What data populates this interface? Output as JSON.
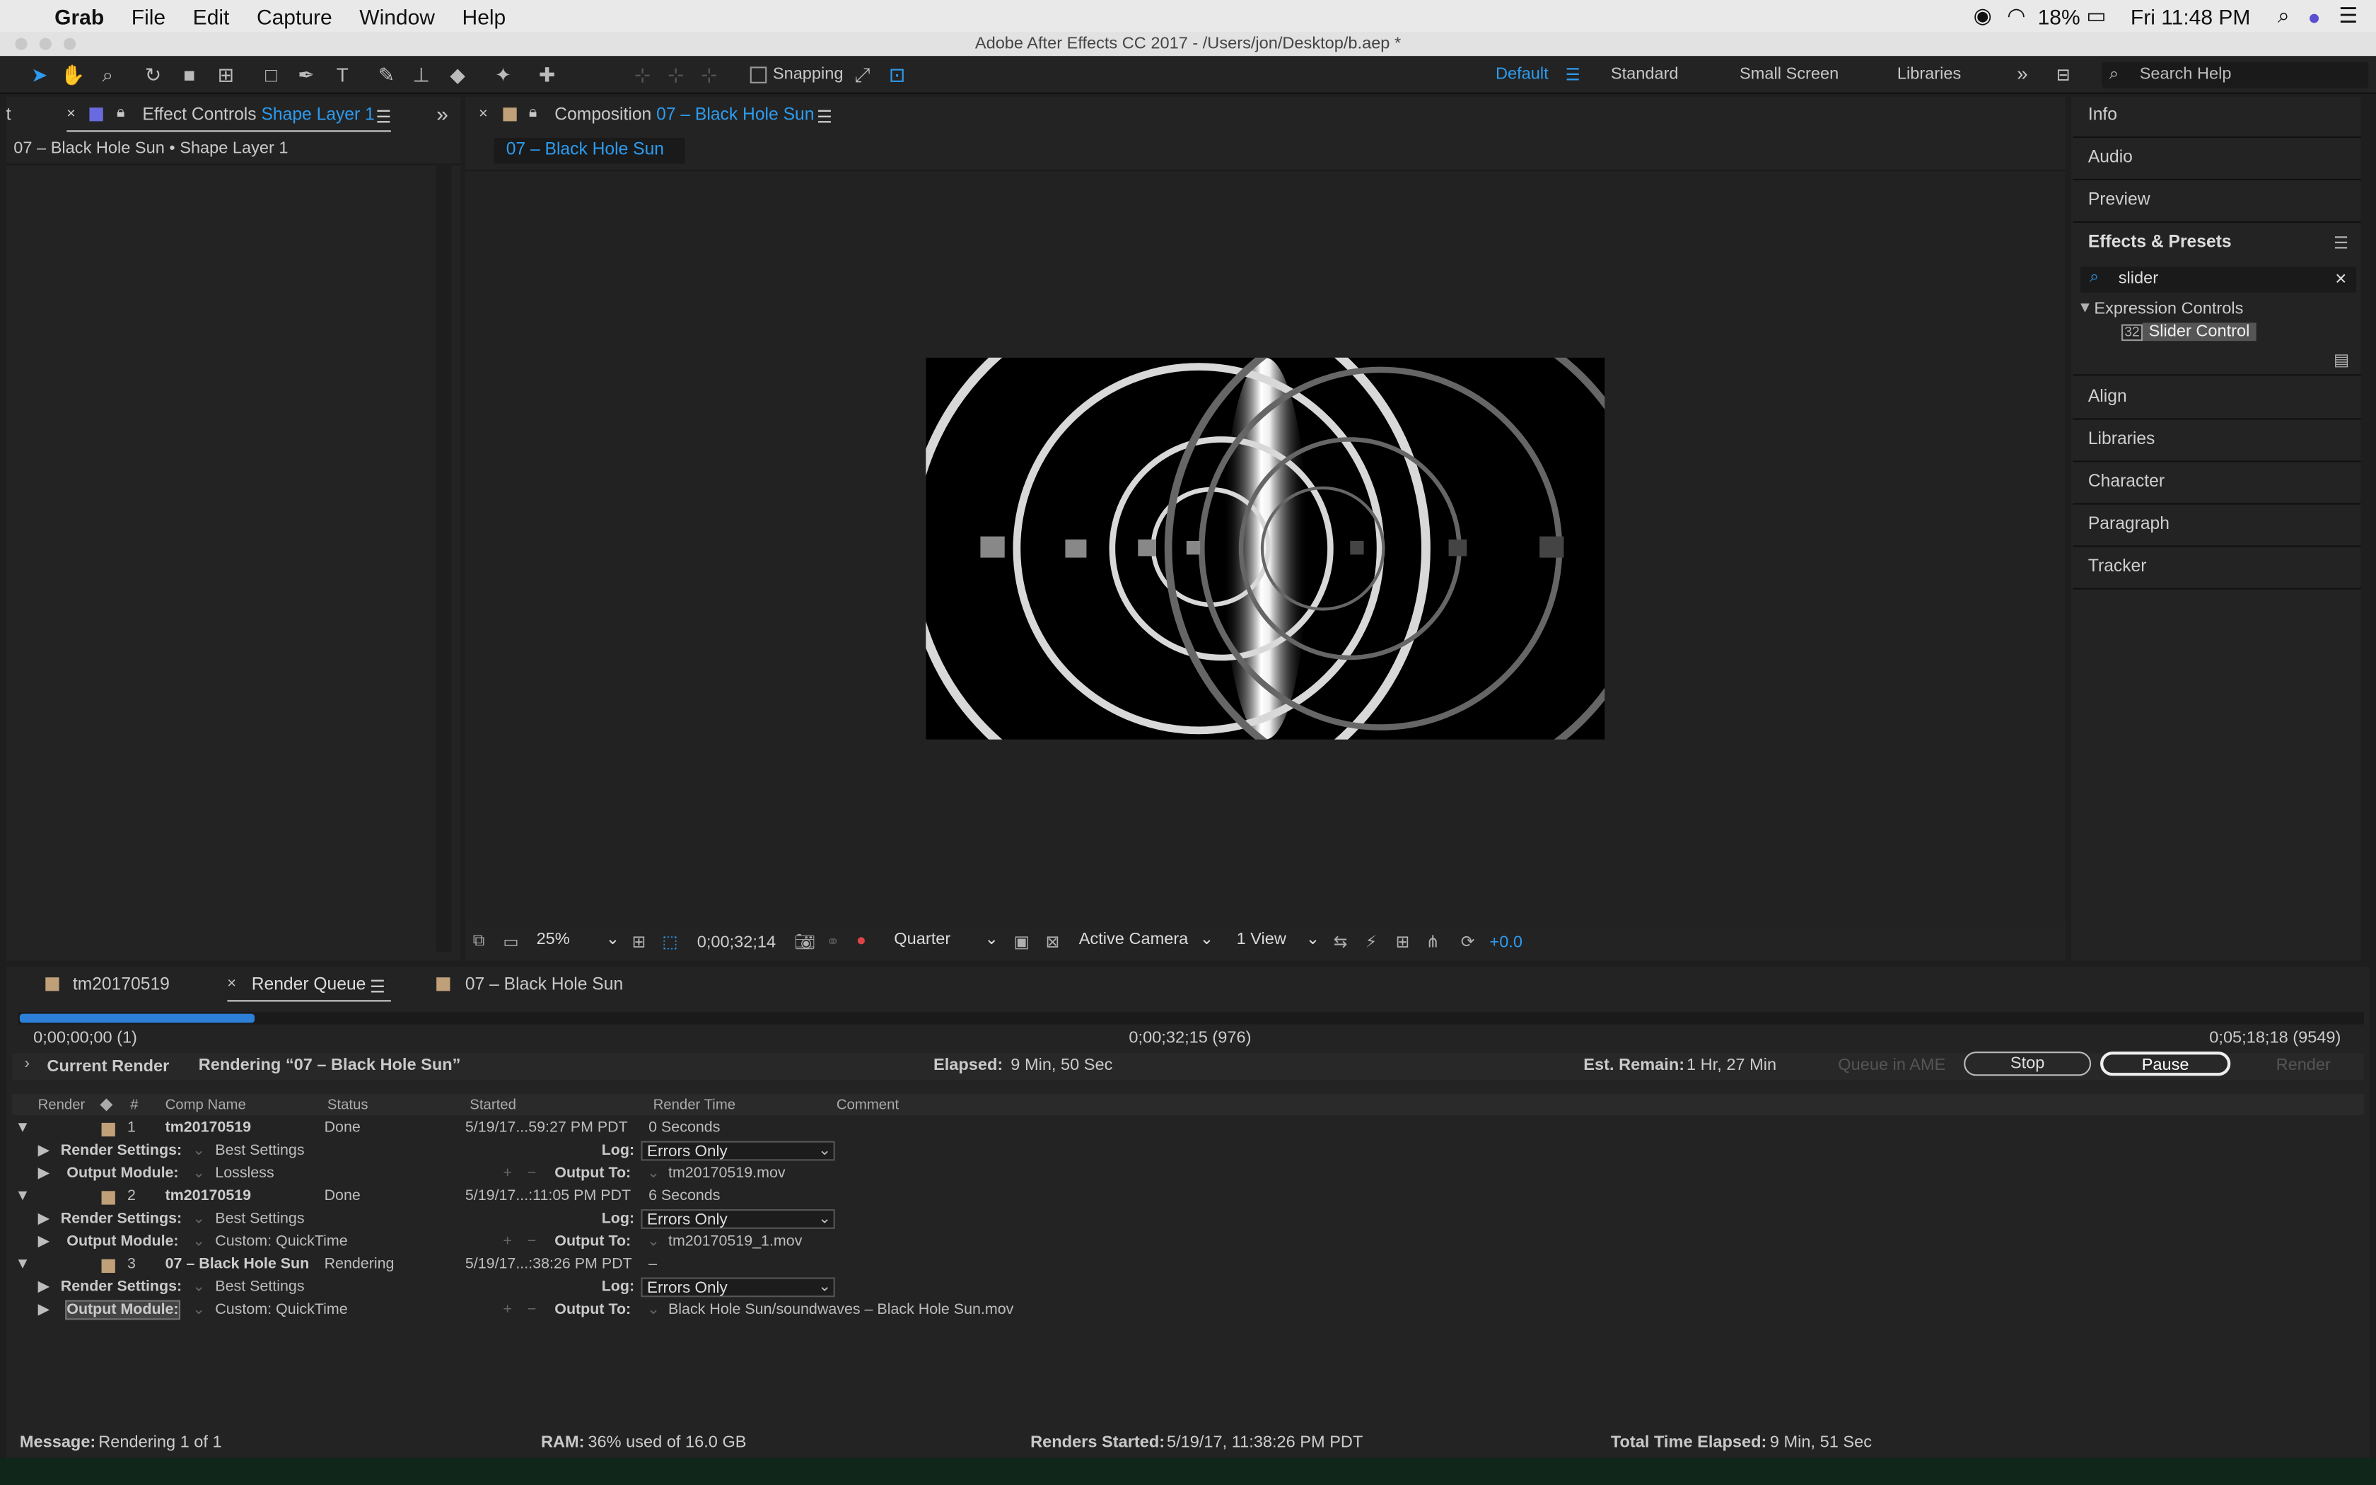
{
  "menubar": {
    "apple": "",
    "app": "Grab",
    "items": [
      "File",
      "Edit",
      "Capture",
      "Window",
      "Help"
    ],
    "battery": "18%",
    "clock": "Fri 11:48 PM"
  },
  "window": {
    "title": "Adobe After Effects CC 2017 - /Users/jon/Desktop/b.aep *"
  },
  "toolbar": {
    "snapping": "Snapping",
    "workspaces": [
      "Default",
      "Standard",
      "Small Screen",
      "Libraries"
    ],
    "search_placeholder": "Search Help"
  },
  "effect_controls": {
    "tab_prefix": "Effect Controls",
    "layer": "Shape Layer 1",
    "breadcrumb": "07 – Black Hole Sun • Shape Layer 1"
  },
  "composition": {
    "tab_prefix": "Composition",
    "comp": "07 – Black Hole Sun",
    "subtab": "07 – Black Hole Sun",
    "zoom": "25%",
    "timecode": "0;00;32;14",
    "resolution": "Quarter",
    "camera": "Active Camera",
    "views": "1 View",
    "exposure": "+0.0"
  },
  "right_panel": {
    "info": "Info",
    "audio": "Audio",
    "preview": "Preview",
    "effects_presets": "Effects & Presets",
    "search_value": "slider",
    "category": "Expression Controls",
    "effect": "Slider Control",
    "align": "Align",
    "libraries": "Libraries",
    "character": "Character",
    "paragraph": "Paragraph",
    "tracker": "Tracker"
  },
  "bottom_tabs": {
    "tab1": "tm20170519",
    "tab2": "Render Queue",
    "tab3": "07 – Black Hole Sun"
  },
  "render": {
    "progress": 0.1,
    "start_tc": "0;00;00;00 (1)",
    "current_tc": "0;00;32;15 (976)",
    "end_tc": "0;05;18;18 (9549)",
    "current_render_label": "Current Render",
    "rendering_text": "Rendering “07 – Black Hole Sun”",
    "elapsed_label": "Elapsed:",
    "elapsed": "9 Min, 50 Sec",
    "remain_label": "Est. Remain:",
    "remain": "1 Hr, 27 Min",
    "queue_ame": "Queue in AME",
    "stop": "Stop",
    "pause": "Pause",
    "render": "Render"
  },
  "columns": [
    "Render",
    "#",
    "Comp Name",
    "Status",
    "Started",
    "Render Time",
    "Comment"
  ],
  "items": [
    {
      "num": "1",
      "comp": "tm20170519",
      "status": "Done",
      "started": "5/19/17...59:27 PM PDT",
      "time": "0 Seconds",
      "settings": "Best Settings",
      "log": "Errors Only",
      "module": "Lossless",
      "output": "tm20170519.mov"
    },
    {
      "num": "2",
      "comp": "tm20170519",
      "status": "Done",
      "started": "5/19/17...:11:05 PM PDT",
      "time": "6 Seconds",
      "settings": "Best Settings",
      "log": "Errors Only",
      "module": "Custom: QuickTime",
      "output": "tm20170519_1.mov"
    },
    {
      "num": "3",
      "comp": "07 – Black Hole Sun",
      "status": "Rendering",
      "started": "5/19/17...:38:26 PM PDT",
      "time": "–",
      "settings": "Best Settings",
      "log": "Errors Only",
      "module": "Custom: QuickTime",
      "output": "Black Hole Sun/soundwaves – Black Hole Sun.mov"
    }
  ],
  "labels": {
    "render_settings": "Render Settings:",
    "output_module": "Output Module:",
    "log": "Log:",
    "output_to": "Output To:"
  },
  "status": {
    "message_label": "Message:",
    "message": "Rendering 1 of 1",
    "ram_label": "RAM:",
    "ram": "36% used of 16.0 GB",
    "started_label": "Renders Started:",
    "started": "5/19/17, 11:38:26 PM PDT",
    "total_label": "Total Time Elapsed:",
    "total": "9 Min, 51 Sec"
  }
}
